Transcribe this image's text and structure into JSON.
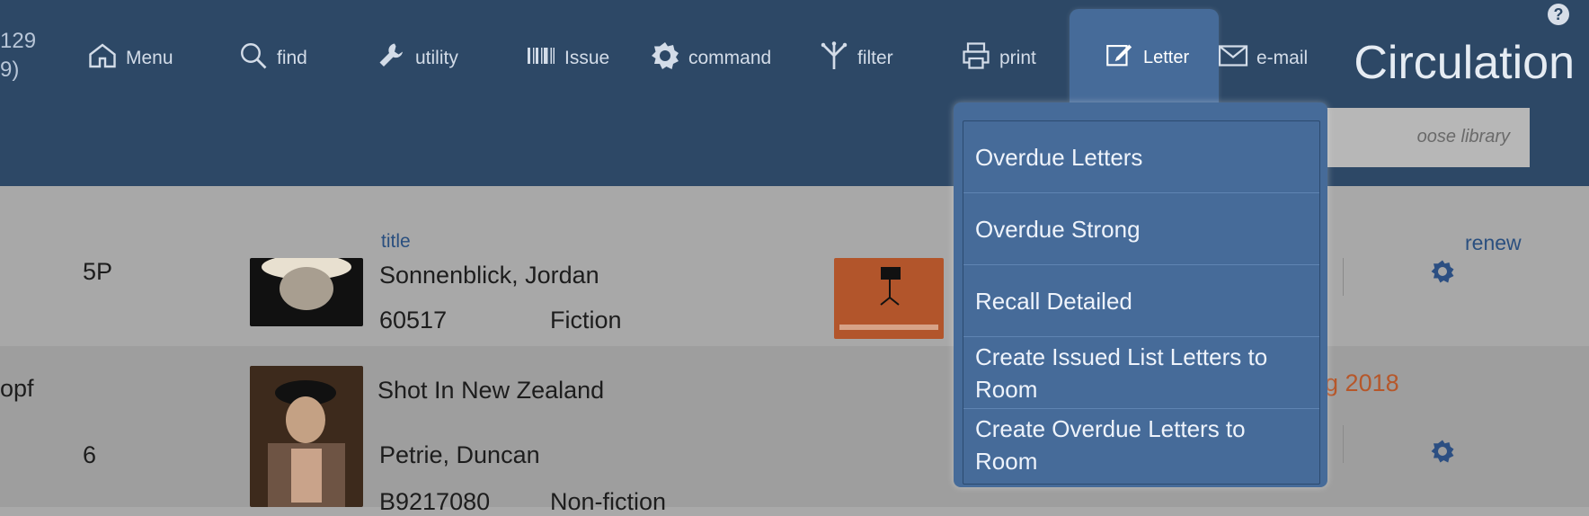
{
  "header": {
    "left_num_line1": "129",
    "left_num_line2": "9)",
    "nav": [
      {
        "id": "menu",
        "label": "Menu",
        "icon": "home-icon"
      },
      {
        "id": "find",
        "label": "find",
        "icon": "search-icon"
      },
      {
        "id": "utility",
        "label": "utility",
        "icon": "wrench-icon"
      },
      {
        "id": "issue",
        "label": "Issue",
        "icon": "barcode-icon"
      },
      {
        "id": "command",
        "label": "command",
        "icon": "gear-icon"
      },
      {
        "id": "filter",
        "label": "filter",
        "icon": "filter-icon"
      },
      {
        "id": "print",
        "label": "print",
        "icon": "printer-icon"
      },
      {
        "id": "letter",
        "label": "Letter",
        "icon": "edit-icon"
      },
      {
        "id": "email",
        "label": "e-mail",
        "icon": "envelope-icon"
      }
    ],
    "app_title": "Circulation",
    "help": "?"
  },
  "search": {
    "placeholder_visible": "oose library"
  },
  "rows": [
    {
      "left_col": "5P",
      "col_label": "title",
      "name": "Sonnenblick, Jordan",
      "id": "60517",
      "type": "Fiction",
      "right_label": "renew"
    },
    {
      "left_col_top": "opf",
      "left_col": "6",
      "title": "Shot In New Zealand",
      "name": "Petrie, Duncan",
      "id": "B9217080",
      "type": "Non-fiction",
      "year_fragment": "g",
      "year": "2018"
    }
  ],
  "letter_menu": [
    {
      "label": "Overdue Letters"
    },
    {
      "label": "Overdue Strong"
    },
    {
      "label": "Recall Detailed"
    },
    {
      "label": "Create Issued List Letters to Room"
    },
    {
      "label": "Create Overdue Letters to Room"
    }
  ],
  "colors": {
    "header_bg": "#2d4866",
    "active_tab_bg": "#466b99",
    "menu_text": "#eef3fb",
    "accent_orange": "#b6572a",
    "link_blue": "#2a4f7f"
  }
}
